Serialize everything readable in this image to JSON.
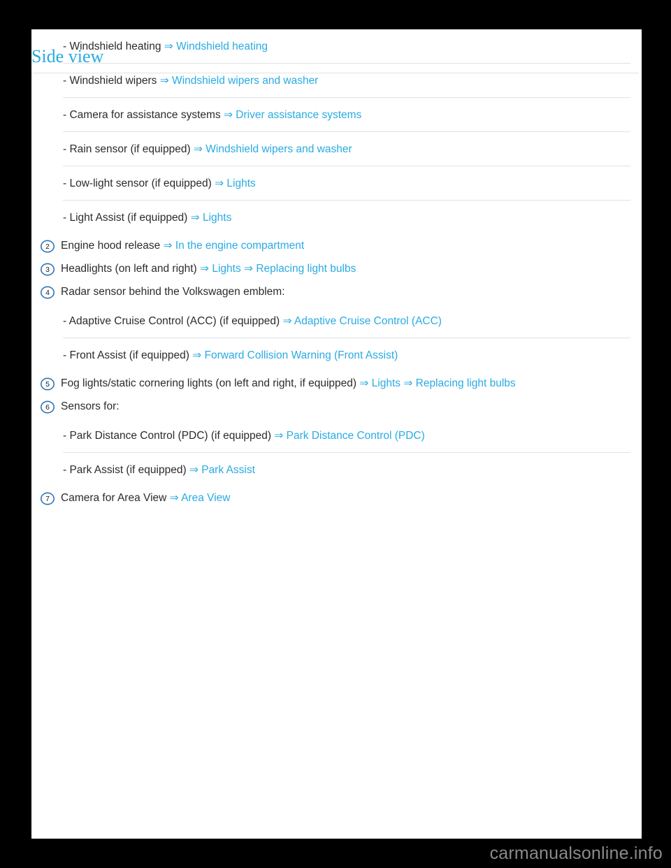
{
  "page": {
    "background_color": "#000000",
    "sheet_color": "#ffffff",
    "link_color": "#29abe2",
    "text_color": "#2b2b2b",
    "separator_color": "#dfe2e4",
    "badge_color": "#2e75b6"
  },
  "arrow_glyph": "⇒",
  "rows": [
    {
      "type": "dash",
      "dash": "-",
      "text": "Windshield heating",
      "links": [
        "Windshield heating"
      ]
    },
    {
      "type": "dash",
      "dash": "-",
      "text": "Windshield wipers",
      "links": [
        "Windshield wipers and washer"
      ]
    },
    {
      "type": "dash",
      "dash": "-",
      "text": "Camera for assistance systems",
      "links": [
        "Driver assistance systems"
      ]
    },
    {
      "type": "dash",
      "dash": "-",
      "text": "Rain sensor (if equipped)",
      "links": [
        "Windshield wipers and washer"
      ]
    },
    {
      "type": "dash",
      "dash": "-",
      "text": "Low-light sensor (if equipped)",
      "links": [
        "Lights"
      ]
    },
    {
      "type": "dash",
      "dash": "-",
      "text": "Light Assist (if equipped)",
      "links": [
        "Lights"
      ]
    },
    {
      "type": "numbered",
      "number": "2",
      "text": "Engine hood release",
      "links": [
        "In the engine compartment"
      ]
    },
    {
      "type": "numbered",
      "number": "3",
      "text": "Headlights (on left and right)",
      "links": [
        "Lights",
        "Replacing light bulbs"
      ]
    },
    {
      "type": "numbered",
      "number": "4",
      "text": "Radar sensor behind the Volkswagen emblem:",
      "links": []
    },
    {
      "type": "dash",
      "dash": "-",
      "text": "Adaptive Cruise Control (ACC) (if equipped)",
      "links": [
        "Adaptive Cruise Control (ACC)"
      ]
    },
    {
      "type": "dash",
      "dash": "-",
      "text": "Front Assist (if equipped)",
      "links": [
        "Forward Collision Warning (Front Assist)"
      ]
    },
    {
      "type": "numbered",
      "number": "5",
      "text": "Fog lights/static cornering lights (on left and right, if equipped)",
      "links": [
        "Lights",
        "Replacing light bulbs"
      ]
    },
    {
      "type": "numbered",
      "number": "6",
      "text": "Sensors for:",
      "links": []
    },
    {
      "type": "dash",
      "dash": "-",
      "text": "Park Distance Control (PDC) (if equipped)",
      "links": [
        "Park Distance Control (PDC)"
      ]
    },
    {
      "type": "dash",
      "dash": "-",
      "text": "Park Assist (if equipped)",
      "links": [
        "Park Assist"
      ]
    },
    {
      "type": "numbered",
      "number": "7",
      "text": "Camera for Area View",
      "links": [
        "Area View"
      ]
    }
  ],
  "heading": {
    "text": "Side view"
  },
  "watermark": {
    "text": "carmanualsonline.info"
  }
}
